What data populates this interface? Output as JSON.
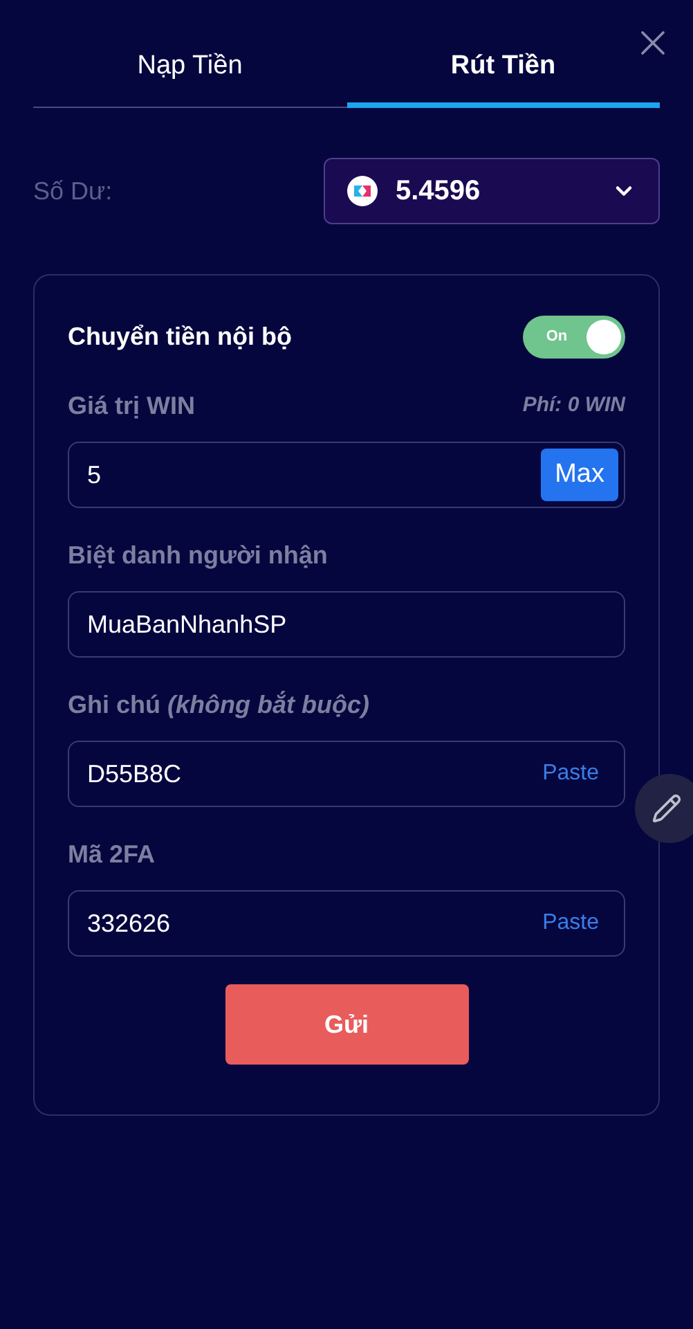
{
  "tabs": [
    {
      "label": "Nạp Tiền",
      "selected": false
    },
    {
      "label": "Rút Tiền",
      "selected": true
    }
  ],
  "balance": {
    "label": "Số Dư:",
    "value": "5.4596"
  },
  "form": {
    "title": "Chuyển tiền nội bộ",
    "toggle": {
      "on": true,
      "label": "On"
    },
    "fields": [
      {
        "label": "Giá trị WIN",
        "hint": "Phí: 0 WIN",
        "value": "5",
        "kind": "max",
        "action": "Max"
      },
      {
        "label": "Biệt danh người nhận",
        "value": "MuaBanNhanhSP",
        "kind": "plain"
      },
      {
        "label": "Ghi chú *(không bắt buộc)*",
        "value": "D55B8C",
        "kind": "paste",
        "action": "Paste"
      },
      {
        "label": "Mã 2FA",
        "value": "332626",
        "kind": "paste",
        "action": "Paste"
      }
    ],
    "submit": "Gửi"
  }
}
